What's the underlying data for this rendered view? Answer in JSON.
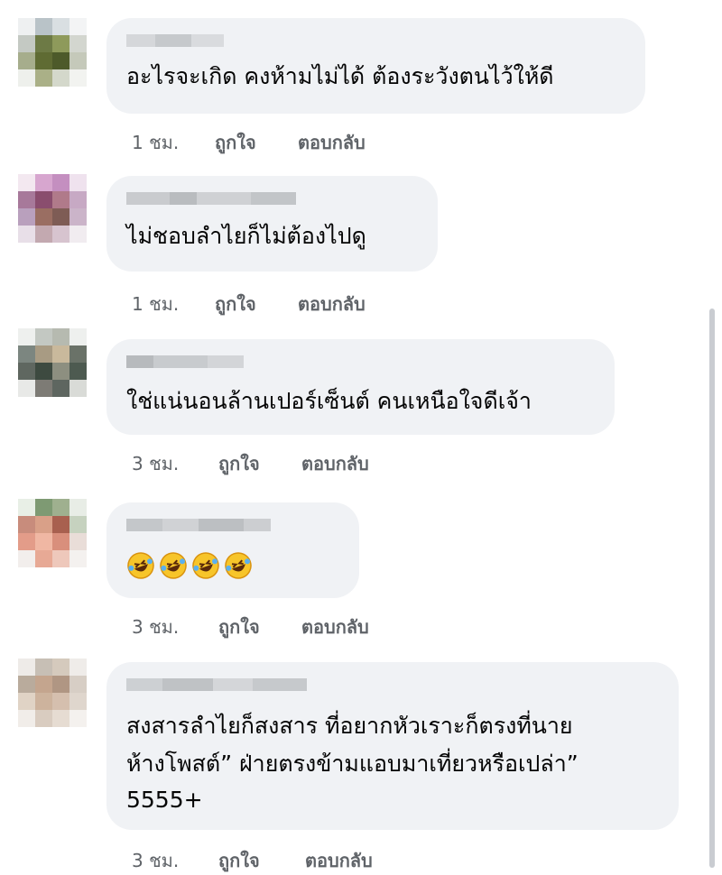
{
  "comments": [
    {
      "text_lines": [
        "อะไรจะเกิด คงห้ามไม่ได้ ต้องระวังตนไว้ให้ดี"
      ],
      "time": "1 ชม.",
      "like": "ถูกใจ",
      "reply": "ตอบกลับ",
      "avatar_colors": [
        "#eef0f1",
        "#b9c3c8",
        "#d9dfe2",
        "#f3f4f5",
        "#c4c9c3",
        "#6d7a45",
        "#8e9a5b",
        "#d3d6cf",
        "#a6ad8c",
        "#5f6b33",
        "#4d5a2a",
        "#c5c9ba",
        "#eef0ec",
        "#aab087",
        "#d4d8cb",
        "#f2f3f0"
      ]
    },
    {
      "text_lines": [
        "ไม่ชอบลำไยก็ไม่ต้องไปดู"
      ],
      "time": "1 ชม.",
      "like": "ถูกใจ",
      "reply": "ตอบกลับ",
      "avatar_colors": [
        "#f3e8f0",
        "#d7a6cf",
        "#c48fc0",
        "#efe2ee",
        "#a7799a",
        "#8a4d6e",
        "#b07a8a",
        "#c7a9c4",
        "#b9a0bd",
        "#9a6e62",
        "#7e5c55",
        "#cbb4c9",
        "#e8dfe8",
        "#c3a9b0",
        "#d7c4cf",
        "#f1ecf0"
      ]
    },
    {
      "text_lines": [
        "ใช่แน่นอนล้านเปอร์เซ็นต์ คนเหนือใจดีเจ้า"
      ],
      "time": "3 ชม.",
      "like": "ถูกใจ",
      "reply": "ตอบกลับ",
      "avatar_colors": [
        "#eef0ee",
        "#c3c8c2",
        "#b6bab0",
        "#eef0ee",
        "#7c8680",
        "#a89b83",
        "#c9b99c",
        "#6a7268",
        "#5f6760",
        "#3d4a40",
        "#8d8f80",
        "#4d5a50",
        "#e8e9e7",
        "#7d7b75",
        "#5e6660",
        "#d9dbd7"
      ]
    },
    {
      "text_lines": [
        ""
      ],
      "emojis": [
        "rofl-emoji",
        "rofl-emoji",
        "rofl-emoji",
        "rofl-emoji"
      ],
      "time": "3 ชม.",
      "like": "ถูกใจ",
      "reply": "ตอบกลับ",
      "avatar_colors": [
        "#e8efe6",
        "#7e9a73",
        "#9fb08f",
        "#e8ede6",
        "#c88c7c",
        "#d9a088",
        "#a8604f",
        "#c6d2bf",
        "#e39c89",
        "#f0b7a3",
        "#d98f7c",
        "#e9ddd8",
        "#f2eeec",
        "#e7a995",
        "#eec8bb",
        "#f4f1ef"
      ]
    },
    {
      "text_lines": [
        "สงสารลำไยก็สงสาร ที่อยากหัวเราะก็ตรงที่นาย",
        "ห้างโพสต์” ฝ่ายตรงข้ามแอบมาเที่ยวหรือเปล่า”",
        "5555+"
      ],
      "time": "3 ชม.",
      "like": "ถูกใจ",
      "reply": "ตอบกลับ",
      "avatar_colors": [
        "#eeebe8",
        "#c7bfb5",
        "#d5cabd",
        "#efece9",
        "#b9ab9c",
        "#c4a58e",
        "#b09683",
        "#d7cec5",
        "#e0d3c5",
        "#cdb39d",
        "#d5bfae",
        "#dfd6cd",
        "#f1ede9",
        "#d9ccc0",
        "#e6dcd2",
        "#f4f1ee"
      ]
    }
  ]
}
